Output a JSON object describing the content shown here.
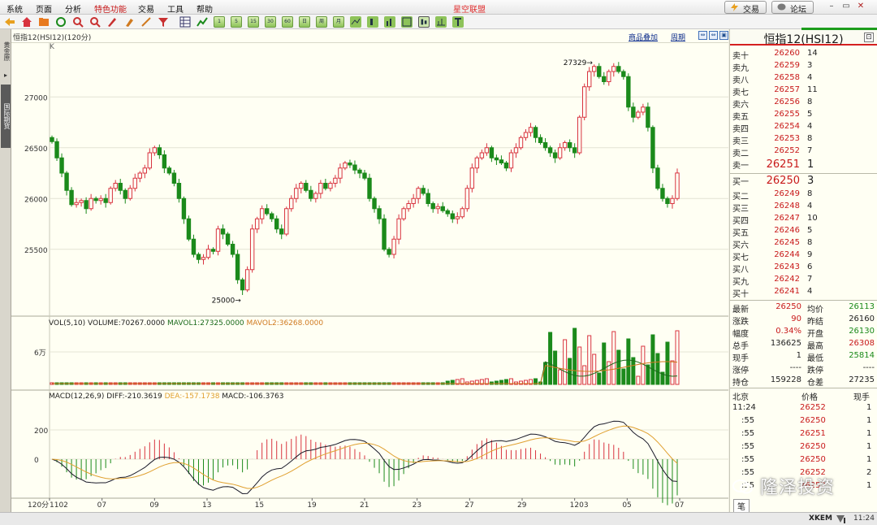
{
  "menubar": {
    "items": [
      {
        "label": "系统",
        "active": false
      },
      {
        "label": "页面",
        "active": false
      },
      {
        "label": "分析",
        "active": false
      },
      {
        "label": "特色功能",
        "active": true
      },
      {
        "label": "交易",
        "active": false
      },
      {
        "label": "工具",
        "active": false
      },
      {
        "label": "帮助",
        "active": false
      }
    ],
    "app_title": "星空联盟",
    "trade_label": "交易",
    "forum_label": "论坛"
  },
  "toolbar": {
    "text_buttons": [
      "1",
      "5",
      "15",
      "30",
      "60",
      "日",
      "周",
      "月"
    ]
  },
  "leftstrip": {
    "tab1": "黄金原",
    "tab2": "国际期货"
  },
  "chart": {
    "symbol": "恒指12",
    "code": "HSI12",
    "period": "120分",
    "type_tag": "K",
    "link_overlay": "商品叠加",
    "link_period": "周期",
    "main_axis": {
      "ticks": [
        "27000",
        "26500",
        "26000",
        "25500"
      ],
      "min": 25000,
      "max": 27329
    },
    "annotations": {
      "high": "27329",
      "low": "25000"
    },
    "volume": {
      "label_prefix": "VOL(5,10)",
      "volume_text": "VOLUME:70267.0000",
      "mavol1_text": "MAVOL1:27325.0000",
      "mavol2_text": "MAVOL2:36268.0000",
      "axis_tick": "6万"
    },
    "macd": {
      "label_prefix": "MACD(12,26,9)",
      "diff_text": "DIFF:-210.3619",
      "dea_text": "DEA:-157.1738",
      "macd_text": "MACD:-106.3763",
      "axis_ticks": [
        "200",
        "0"
      ]
    },
    "x_axis": {
      "period_label": "120分",
      "dates": [
        "1102",
        "07",
        "09",
        "13",
        "15",
        "19",
        "21",
        "23",
        "27",
        "29",
        "1203",
        "05",
        "07"
      ]
    },
    "colors": {
      "up": "#d8333f",
      "down": "#1b8a1b",
      "diff": "#1a1a2a",
      "dea": "#e0a030",
      "mavol1": "#1b6a1b",
      "mavol2": "#d07a20"
    }
  },
  "chart_data": {
    "type": "candlestick",
    "title": "恒指12(HSI12)",
    "period": "120分",
    "highest": 27329,
    "lowest": 25000,
    "close_series": [
      26560,
      26400,
      26250,
      26080,
      25940,
      25960,
      25980,
      25900,
      26000,
      25980,
      26000,
      25960,
      26100,
      26150,
      26080,
      26000,
      26100,
      26200,
      26250,
      26300,
      26450,
      26500,
      26430,
      26300,
      26250,
      26150,
      26000,
      25800,
      25600,
      25450,
      25400,
      25420,
      25500,
      25480,
      25700,
      25650,
      25550,
      25450,
      25200,
      25100,
      25300,
      25700,
      25800,
      25900,
      25850,
      25800,
      25700,
      25650,
      25900,
      26000,
      26100,
      26150,
      26080,
      26000,
      26050,
      26150,
      26100,
      26150,
      26200,
      26300,
      26350,
      26330,
      26280,
      26250,
      26200,
      26000,
      25900,
      25800,
      25500,
      25450,
      25600,
      25800,
      25900,
      25950,
      26000,
      26100,
      26050,
      25950,
      25900,
      25920,
      25880,
      25850,
      25800,
      25820,
      25900,
      26100,
      26300,
      26400,
      26450,
      26500,
      26400,
      26380,
      26350,
      26300,
      26450,
      26500,
      26600,
      26650,
      26700,
      26600,
      26550,
      26500,
      26450,
      26400,
      26500,
      26550,
      26500,
      26450,
      26800,
      27100,
      27250,
      27300,
      27200,
      27150,
      27250,
      27300,
      27250,
      27200,
      26900,
      26800,
      26850,
      26900,
      26700,
      26300,
      26100,
      26000,
      25950,
      26000,
      26251
    ]
  },
  "orderbook": {
    "title": "恒指12(HSI12)",
    "asks": [
      {
        "label": "卖十",
        "price": "26260",
        "vol": "14"
      },
      {
        "label": "卖九",
        "price": "26259",
        "vol": "3"
      },
      {
        "label": "卖八",
        "price": "26258",
        "vol": "4"
      },
      {
        "label": "卖七",
        "price": "26257",
        "vol": "11"
      },
      {
        "label": "卖六",
        "price": "26256",
        "vol": "8"
      },
      {
        "label": "卖五",
        "price": "26255",
        "vol": "5"
      },
      {
        "label": "卖四",
        "price": "26254",
        "vol": "4"
      },
      {
        "label": "卖三",
        "price": "26253",
        "vol": "8"
      },
      {
        "label": "卖二",
        "price": "26252",
        "vol": "7"
      },
      {
        "label": "卖一",
        "price": "26251",
        "vol": "1"
      }
    ],
    "bids": [
      {
        "label": "买一",
        "price": "26250",
        "vol": "3"
      },
      {
        "label": "买二",
        "price": "26249",
        "vol": "8"
      },
      {
        "label": "买三",
        "price": "26248",
        "vol": "4"
      },
      {
        "label": "买四",
        "price": "26247",
        "vol": "10"
      },
      {
        "label": "买五",
        "price": "26246",
        "vol": "5"
      },
      {
        "label": "买六",
        "price": "26245",
        "vol": "8"
      },
      {
        "label": "买七",
        "price": "26244",
        "vol": "9"
      },
      {
        "label": "买八",
        "price": "26243",
        "vol": "6"
      },
      {
        "label": "买九",
        "price": "26242",
        "vol": "7"
      },
      {
        "label": "买十",
        "price": "26241",
        "vol": "4"
      }
    ]
  },
  "stats": [
    {
      "l1": "最新",
      "v1": "26250",
      "c1": "#c8191a",
      "l2": "均价",
      "v2": "26113",
      "c2": "#1b8a1b"
    },
    {
      "l1": "涨跌",
      "v1": "90",
      "c1": "#c8191a",
      "l2": "昨结",
      "v2": "26160",
      "c2": "#222"
    },
    {
      "l1": "幅度",
      "v1": "0.34%",
      "c1": "#c8191a",
      "l2": "开盘",
      "v2": "26130",
      "c2": "#1b8a1b"
    },
    {
      "l1": "总手",
      "v1": "136625",
      "c1": "#222",
      "l2": "最高",
      "v2": "26308",
      "c2": "#c8191a"
    },
    {
      "l1": "现手",
      "v1": "1",
      "c1": "#222",
      "l2": "最低",
      "v2": "25814",
      "c2": "#1b8a1b"
    },
    {
      "l1": "涨停",
      "v1": "----",
      "c1": "#222",
      "l2": "跌停",
      "v2": "----",
      "c2": "#222"
    },
    {
      "l1": "持仓",
      "v1": "159228",
      "c1": "#222",
      "l2": "仓差",
      "v2": "27235",
      "c2": "#222"
    }
  ],
  "ticks": {
    "header": {
      "place": "北京",
      "price": "价格",
      "qty": "现手"
    },
    "rows": [
      {
        "time": "11:24",
        "price": "26252",
        "qty": "1"
      },
      {
        "time": ":55",
        "price": "26250",
        "qty": "1"
      },
      {
        "time": ":55",
        "price": "26251",
        "qty": "1"
      },
      {
        "time": ":55",
        "price": "26250",
        "qty": "1"
      },
      {
        "time": ":55",
        "price": "26250",
        "qty": "1"
      },
      {
        "time": ":55",
        "price": "26252",
        "qty": "2"
      },
      {
        "time": ":55",
        "price": "26252",
        "qty": "1"
      }
    ],
    "footer_tab": "笔"
  },
  "statusbar": {
    "brand": "XKEM",
    "time": "11:24"
  },
  "watermark": "隆泽投资"
}
